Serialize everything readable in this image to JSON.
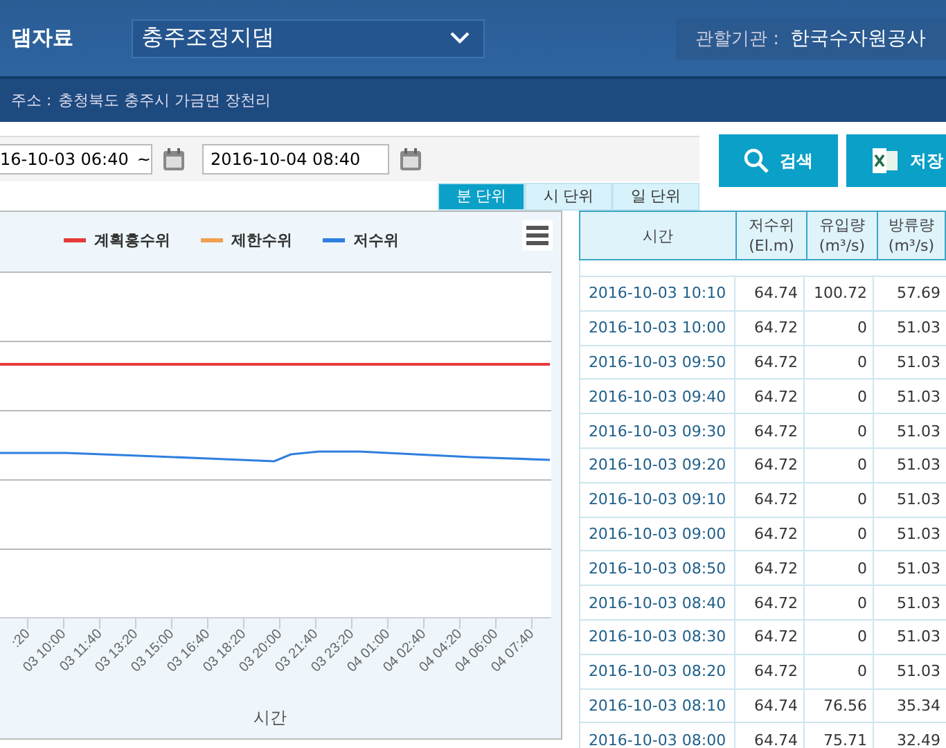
{
  "header": {
    "title": "댐자료",
    "dam_select": {
      "value": "충주조정지댐"
    },
    "agency_label": "관할기관 :",
    "agency": "한국수자원공사"
  },
  "address": {
    "label": "주소 :",
    "value": "충청북도 충주시 가금면 장천리"
  },
  "filter": {
    "start": "16-10-03 06:40",
    "separator": "~",
    "end": "2016-10-04 08:40"
  },
  "buttons": [
    {
      "kind": "search",
      "label": "검색"
    },
    {
      "kind": "excel",
      "label": "저장"
    }
  ],
  "tabs": [
    {
      "label": "분 단위",
      "selected": true
    },
    {
      "label": "시 단위",
      "selected": false
    },
    {
      "label": "일 단위",
      "selected": false
    }
  ],
  "chart": {
    "legend": [
      {
        "name": "계획홍수위",
        "color": "#e8393a"
      },
      {
        "name": "제한수위",
        "color": "#f0a050"
      },
      {
        "name": "저수위",
        "color": "#2f7fe0"
      }
    ],
    "xtick_labels": [
      ":20",
      "03 10:00",
      "03 11:40",
      "03 13:20",
      "03 15:00",
      "03 16:40",
      "03 18:20",
      "03 20:00",
      "03 21:40",
      "03 23:20",
      "04 01:00",
      "04 02:40",
      "04 04:20",
      "04 06:00",
      "04 07:40"
    ],
    "xlabel": "시간"
  },
  "table": {
    "columns": [
      {
        "label": "시간"
      },
      {
        "label": "저수위",
        "unit": "(El.m)"
      },
      {
        "label": "유입량",
        "unit": "(m³/s)"
      },
      {
        "label": "방류량",
        "unit": "(m³/s)"
      }
    ],
    "rows": [
      [
        "2016-10-03 10:10",
        "64.74",
        "100.72",
        "57.69"
      ],
      [
        "2016-10-03 10:00",
        "64.72",
        "0",
        "51.03"
      ],
      [
        "2016-10-03 09:50",
        "64.72",
        "0",
        "51.03"
      ],
      [
        "2016-10-03 09:40",
        "64.72",
        "0",
        "51.03"
      ],
      [
        "2016-10-03 09:30",
        "64.72",
        "0",
        "51.03"
      ],
      [
        "2016-10-03 09:20",
        "64.72",
        "0",
        "51.03"
      ],
      [
        "2016-10-03 09:10",
        "64.72",
        "0",
        "51.03"
      ],
      [
        "2016-10-03 09:00",
        "64.72",
        "0",
        "51.03"
      ],
      [
        "2016-10-03 08:50",
        "64.72",
        "0",
        "51.03"
      ],
      [
        "2016-10-03 08:40",
        "64.72",
        "0",
        "51.03"
      ],
      [
        "2016-10-03 08:30",
        "64.72",
        "0",
        "51.03"
      ],
      [
        "2016-10-03 08:20",
        "64.72",
        "0",
        "51.03"
      ],
      [
        "2016-10-03 08:10",
        "64.74",
        "76.56",
        "35.34"
      ],
      [
        "2016-10-03 08:00",
        "64.74",
        "75.71",
        "32.49"
      ]
    ]
  }
}
